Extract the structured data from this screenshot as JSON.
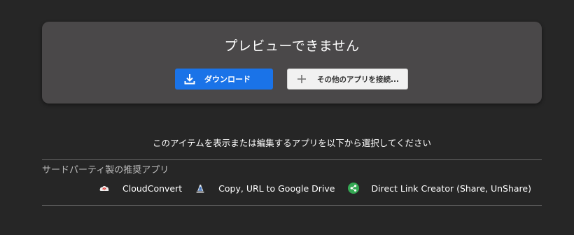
{
  "preview": {
    "title": "プレビューできません",
    "download_label": "ダウンロード",
    "connect_label": "その他のアプリを接続..."
  },
  "open_with": {
    "message": "このアイテムを表示または編集するアプリを以下から選択してください"
  },
  "third_party": {
    "section_title": "サードパーティ製の推奨アプリ",
    "apps": [
      {
        "label": "CloudConvert",
        "icon": "cloudconvert-icon"
      },
      {
        "label": "Copy, URL to Google Drive",
        "icon": "copy-url-icon"
      },
      {
        "label": "Direct Link Creator (Share, UnShare)",
        "icon": "share-icon"
      }
    ]
  },
  "colors": {
    "background": "#262626",
    "card": "#4a4849",
    "primary_button": "#1a73e8",
    "share_icon_green": "#34a853"
  }
}
